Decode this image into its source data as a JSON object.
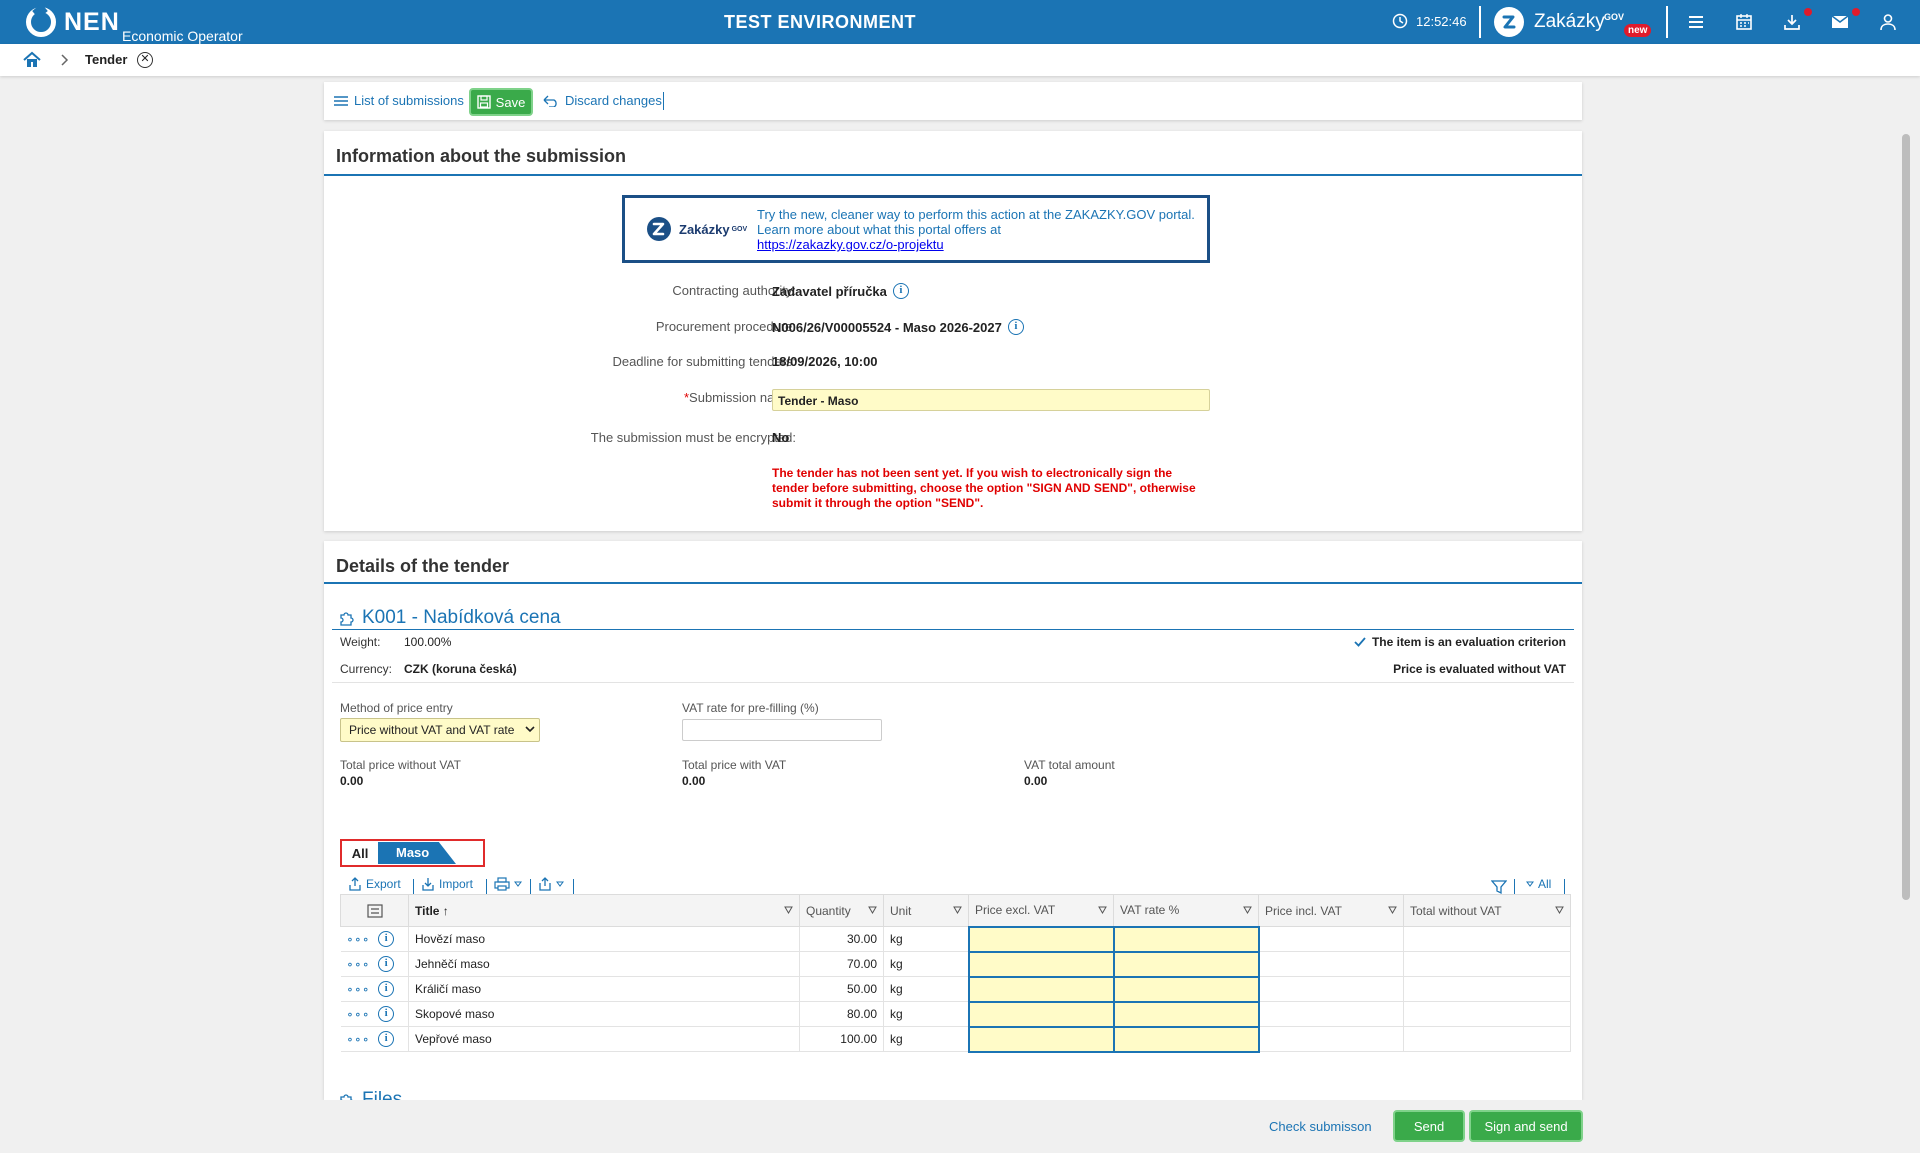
{
  "header": {
    "logo_text": "NEN",
    "logo_sub": "Economic Operator",
    "environment": "TEST ENVIRONMENT",
    "time": "12:52:46",
    "portal_name": "Zakázky",
    "portal_gov": "GOV",
    "portal_badge": "new",
    "colors": {
      "primary": "#1b74b4",
      "badge": "#e01b2b",
      "save": "#3aaa4a",
      "highlight": "#fffbc8",
      "warning": "#e00000"
    }
  },
  "breadcrumb": {
    "current": "Tender"
  },
  "toolbar": {
    "list_label": "List of submissions",
    "save_label": "Save",
    "discard_label": "Discard changes"
  },
  "info": {
    "title": "Information about the submission",
    "banner_brand": "Zakázky",
    "banner_gov": "GOV",
    "banner_text_1": "Try the new, cleaner way to perform this action at the ZAKAZKY.GOV portal.",
    "banner_text_2": "Learn more about what this portal offers at",
    "banner_link": "https://zakazky.gov.cz/o-projektu",
    "fields": [
      {
        "label": "Contracting authority:",
        "value": "Zadavatel příručka"
      },
      {
        "label": "Procurement procedure:",
        "value": "N006/26/V00005524 - Maso 2026-2027"
      },
      {
        "label": "Deadline for submitting tenders:",
        "value": "18/09/2026, 10:00"
      },
      {
        "label": "Submission name:",
        "value": "Tender - Maso",
        "required": "*"
      },
      {
        "label": "The submission must be encrypted:",
        "value": "No"
      }
    ],
    "warning": "The tender has not been sent yet. If you wish to electronically sign the tender before submitting, choose the option \"SIGN AND SEND\", otherwise submit it through the option \"SEND\"."
  },
  "details": {
    "title": "Details of the tender",
    "item_title": "K001 - Nabídková cena",
    "weight_label": "Weight:",
    "weight": "100.00%",
    "currency_label": "Currency:",
    "currency": "CZK (koruna česká)",
    "criterion_text": "The item is an evaluation criterion",
    "price_eval_text": "Price is evaluated without VAT",
    "method_label": "Method of price entry",
    "method_value": "Price without VAT and VAT rate",
    "vat_prefill_label": "VAT rate for pre-filling (%)",
    "totals": [
      {
        "label": "Total price without VAT",
        "value": "0.00"
      },
      {
        "label": "Total price with VAT",
        "value": "0.00"
      },
      {
        "label": "VAT total amount",
        "value": "0.00"
      }
    ],
    "tabs": {
      "all": "All",
      "maso": "Maso"
    },
    "table_toolbar": {
      "export": "Export",
      "import": "Import",
      "filter_all": "All"
    },
    "columns": [
      "Title",
      "Quantity",
      "Unit",
      "Price excl. VAT",
      "VAT rate %",
      "Price incl. VAT",
      "Total without VAT"
    ],
    "rows": [
      {
        "title": "Hovězí maso",
        "quantity": "30.00",
        "unit": "kg"
      },
      {
        "title": "Jehněčí maso",
        "quantity": "70.00",
        "unit": "kg"
      },
      {
        "title": "Králičí maso",
        "quantity": "50.00",
        "unit": "kg"
      },
      {
        "title": "Skopové maso",
        "quantity": "80.00",
        "unit": "kg"
      },
      {
        "title": "Vepřové maso",
        "quantity": "100.00",
        "unit": "kg"
      }
    ],
    "next_section_partial": "Files"
  },
  "footer": {
    "check": "Check submisson",
    "send": "Send",
    "sign_send": "Sign and send"
  }
}
